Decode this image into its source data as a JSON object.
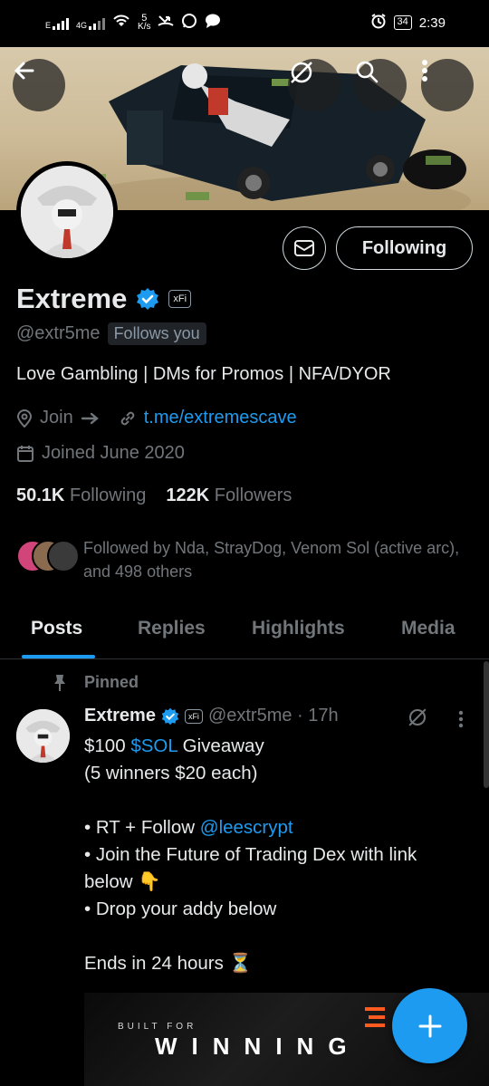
{
  "status_bar": {
    "network_left": "E",
    "network_right": "4G",
    "speed_value": "5",
    "speed_unit": "K/s",
    "battery": "34",
    "time": "2:39"
  },
  "banner_actions": {
    "back_icon": "arrow-left-icon",
    "grok_icon": "grok-icon",
    "search_icon": "search-icon",
    "more_icon": "more-vertical-icon"
  },
  "profile": {
    "follow_label": "Following",
    "name": "Extreme",
    "badge_label": "xFi",
    "handle": "@extr5me",
    "follows_you": "Follows you",
    "bio": "Love Gambling | DMs for Promos | NFA/DYOR",
    "join_label": "Join",
    "link": "t.me/extremescave",
    "joined": "Joined June 2020",
    "following_count": "50.1K",
    "following_label": "Following",
    "followers_count": "122K",
    "followers_label": "Followers",
    "followed_by": "Followed by Nda, StrayDog, Venom Sol (active arc), and 498 others"
  },
  "tabs": [
    {
      "label": "Posts"
    },
    {
      "label": "Replies"
    },
    {
      "label": "Highlights"
    },
    {
      "label": "Media"
    }
  ],
  "post": {
    "pinned_label": "Pinned",
    "name": "Extreme",
    "badge_label": "xFi",
    "handle_time": "@extr5me · 17h",
    "line1_pre": "$100 ",
    "cashtag": "$SOL",
    "line1_post": " Giveaway",
    "line2": "(5 winners $20 each)",
    "bullet1_pre": "• RT + Follow ",
    "mention": "@leescrypt",
    "bullet2": "• Join the Future of Trading Dex with link below 👇",
    "bullet3": "• Drop your addy below",
    "ends": "Ends in 24 hours ⏳",
    "media_built": "BUILT FOR",
    "media_winning": "WINNING"
  },
  "colors": {
    "accent": "#1d9bf0",
    "background": "#000000",
    "text_primary": "#e7e9ea",
    "text_secondary": "#71767b"
  }
}
